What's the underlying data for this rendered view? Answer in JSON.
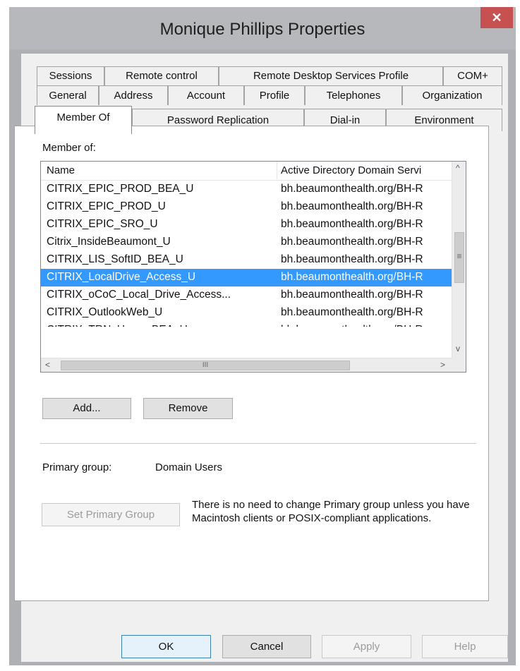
{
  "window": {
    "title": "Monique Phillips Properties",
    "close_glyph": "✕"
  },
  "tabs": {
    "row1": [
      "Sessions",
      "Remote control",
      "Remote Desktop Services Profile",
      "COM+"
    ],
    "row2": [
      "General",
      "Address",
      "Account",
      "Profile",
      "Telephones",
      "Organization"
    ],
    "row3": [
      "Member Of",
      "Password Replication",
      "Dial-in",
      "Environment"
    ],
    "active": "Member Of"
  },
  "member_of": {
    "label": "Member of:",
    "columns": [
      "Name",
      "Active Directory Domain Servi"
    ],
    "rows": [
      [
        "CITRIX_EPIC_PROD_BEA_U",
        "bh.beaumonthealth.org/BH-R"
      ],
      [
        "CITRIX_EPIC_PROD_U",
        "bh.beaumonthealth.org/BH-R"
      ],
      [
        "CITRIX_EPIC_SRO_U",
        "bh.beaumonthealth.org/BH-R"
      ],
      [
        "Citrix_InsideBeaumont_U",
        "bh.beaumonthealth.org/BH-R"
      ],
      [
        "CITRIX_LIS_SoftID_BEA_U",
        "bh.beaumonthealth.org/BH-R"
      ],
      [
        "CITRIX_LocalDrive_Access_U",
        "bh.beaumonthealth.org/BH-R"
      ],
      [
        "CITRIX_oCoC_Local_Drive_Access...",
        "bh.beaumonthealth.org/BH-R"
      ],
      [
        "CITRIX_OutlookWeb_U",
        "bh.beaumonthealth.org/BH-R"
      ],
      [
        "CITRIX_TRN_Users_BEA_U",
        "bh.beaumonthealth.org/BH-R"
      ]
    ],
    "selected_row_index": 5
  },
  "scrollbar_glyphs": {
    "up": "^",
    "down": "v",
    "left": "<",
    "right": ">",
    "grip": "≡",
    "hgrip": "III"
  },
  "buttons": {
    "add": "Add...",
    "remove": "Remove",
    "set_primary": "Set Primary Group"
  },
  "primary_group": {
    "label": "Primary group:",
    "value": "Domain Users",
    "note": "There is no need to change Primary group unless you have Macintosh clients or POSIX-compliant applications."
  },
  "dialog_buttons": {
    "ok": "OK",
    "cancel": "Cancel",
    "apply": "Apply",
    "help": "Help"
  }
}
